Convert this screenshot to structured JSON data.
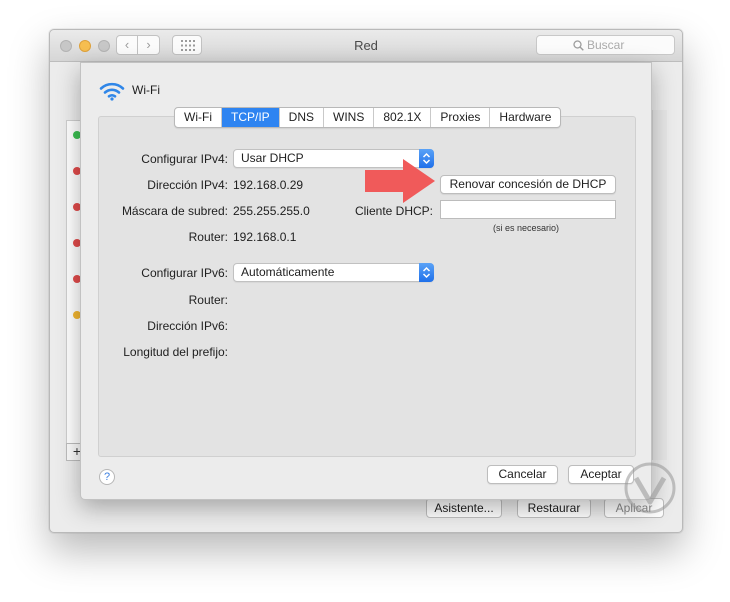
{
  "window": {
    "title": "Red",
    "search_placeholder": "Buscar",
    "buttons": {
      "assistant": "Asistente...",
      "restore": "Restaurar",
      "apply": "Aplicar"
    },
    "add_symbol": "+"
  },
  "sheet": {
    "service_name": "Wi-Fi",
    "tabs": [
      {
        "label": "Wi-Fi",
        "active": false
      },
      {
        "label": "TCP/IP",
        "active": true
      },
      {
        "label": "DNS",
        "active": false
      },
      {
        "label": "WINS",
        "active": false
      },
      {
        "label": "802.1X",
        "active": false
      },
      {
        "label": "Proxies",
        "active": false
      },
      {
        "label": "Hardware",
        "active": false
      }
    ],
    "ipv4": {
      "configure_label": "Configurar IPv4:",
      "configure_value": "Usar DHCP",
      "address_label": "Dirección IPv4:",
      "address_value": "192.168.0.29",
      "subnet_label": "Máscara de subred:",
      "subnet_value": "255.255.255.0",
      "router_label": "Router:",
      "router_value": "192.168.0.1",
      "renew_button": "Renovar concesión de DHCP",
      "dhcp_client_label": "Cliente DHCP:",
      "dhcp_client_value": "",
      "dhcp_hint": "(si es necesario)"
    },
    "ipv6": {
      "configure_label": "Configurar IPv6:",
      "configure_value": "Automáticamente",
      "router_label": "Router:",
      "address_label": "Dirección IPv6:",
      "prefix_label": "Longitud del prefijo:"
    },
    "help_symbol": "?",
    "cancel_button": "Cancelar",
    "accept_button": "Aceptar"
  },
  "colors": {
    "accent": "#2e84f1",
    "highlight_arrow": "#f05a5a",
    "status_green": "#3cc152",
    "status_red": "#e24b4b",
    "status_yellow": "#f4b731"
  }
}
